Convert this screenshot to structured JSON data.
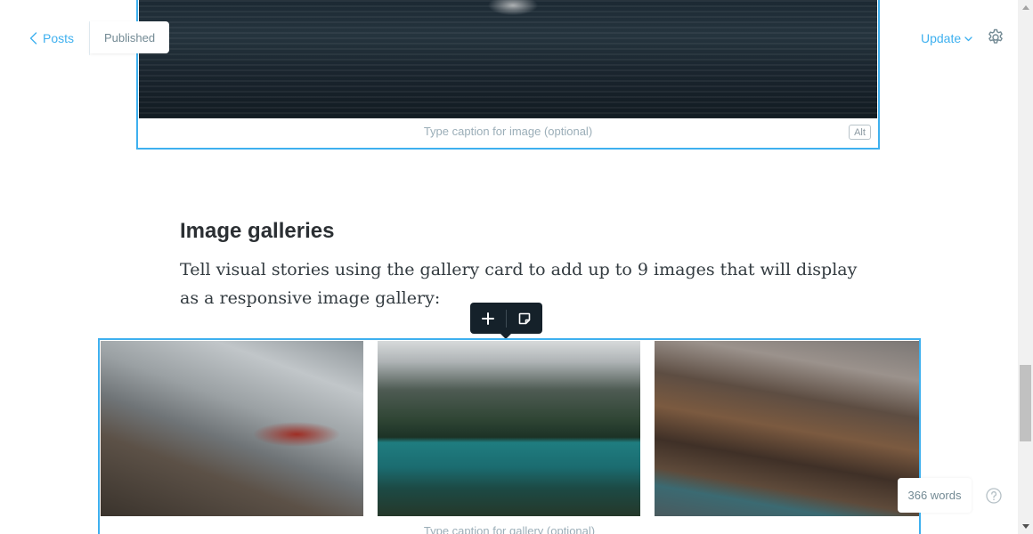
{
  "header": {
    "back_label": "Posts",
    "status_label": "Published",
    "update_label": "Update"
  },
  "editor": {
    "image_card": {
      "caption_placeholder": "Type caption for image (optional)",
      "alt_label": "Alt"
    },
    "heading": "Image galleries",
    "paragraph": "Tell visual stories using the gallery card to add up to 9 images that will display as a responsive image gallery:",
    "gallery_card": {
      "caption_placeholder": "Type caption for gallery (optional)"
    }
  },
  "footer": {
    "word_count": "366 words"
  },
  "colors": {
    "accent": "#3eb0ef",
    "toolbar_bg": "#15212a",
    "muted_text": "#738a94"
  },
  "icons": [
    "chevron-left-icon",
    "chevron-down-icon",
    "gear-icon",
    "plus-icon",
    "snippet-icon",
    "help-icon"
  ]
}
